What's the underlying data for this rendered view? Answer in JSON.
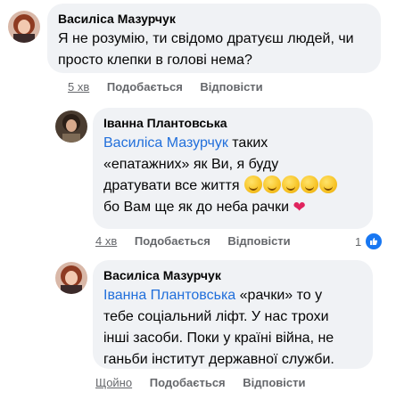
{
  "comments": [
    {
      "author": "Василіса Мазурчук",
      "text": "Я не розумію, ти свідомо дратуєш людей, чи просто клепки в голові нема?",
      "time": "5 хв",
      "like_label": "Подобається",
      "reply_label": "Відповісти"
    },
    {
      "author": "Іванна Плантовська",
      "mention": "Василіса Мазурчук",
      "text_line1": " таких",
      "text_line2": "«епатажних» як Ви, я буду",
      "text_line3": "дратувати все життя",
      "text_line4": "бо Вам ще як до неба рачки",
      "emoji_name": "rofl-emoji",
      "heart_name": "red-heart-emoji",
      "time": "4 хв",
      "like_label": "Подобається",
      "reply_label": "Відповісти",
      "reaction_count": "1"
    },
    {
      "author": "Василіса Мазурчук",
      "mention": "Іванна Плантовська",
      "text_line1": " «рачки» то у",
      "text_line2": "тебе соціальний ліфт. У нас трохи",
      "text_line3": "інші засоби. Поки у країні війна, не",
      "text_line4": "ганьби інститут державної служби.",
      "time": "Щойно",
      "like_label": "Подобається",
      "reply_label": "Відповісти"
    }
  ],
  "colors": {
    "bubble": "#f0f2f5",
    "mention": "#216fdb",
    "meta": "#65676b",
    "like": "#1877f2"
  }
}
